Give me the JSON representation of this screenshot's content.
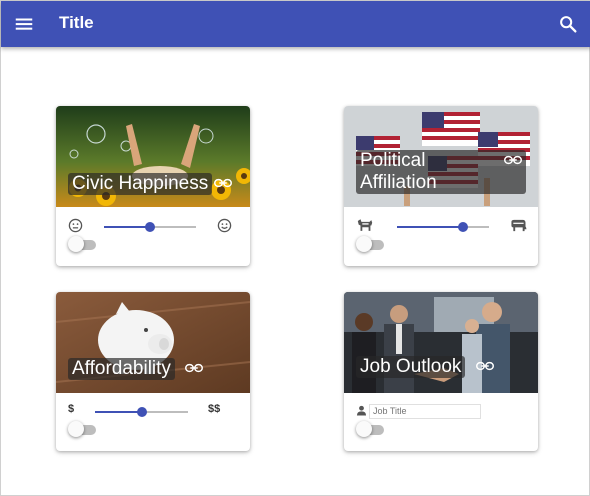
{
  "app": {
    "title": "Title"
  },
  "cards": [
    {
      "title": "Civic Happiness",
      "link_icon": "link-icon",
      "start_icon": "neutral-face-icon",
      "end_icon": "smile-face-icon",
      "slider_value": 0.5,
      "toggle_on": false
    },
    {
      "title_line1": "Political",
      "title_line2": "Affiliation",
      "link_icon": "link-icon",
      "start_icon": "donkey-icon",
      "end_icon": "elephant-icon",
      "slider_value": 0.72,
      "toggle_on": false
    },
    {
      "title": "Affordability",
      "link_icon": "link-icon",
      "start_label": "$",
      "end_label": "$$",
      "slider_value": 0.5,
      "toggle_on": false
    },
    {
      "title": "Job Outlook",
      "link_icon": "link-icon",
      "input_icon": "person-icon",
      "input_placeholder": "Job Title",
      "toggle_on": false
    }
  ],
  "colors": {
    "primary": "#3f51b5",
    "track": "#bdbdbd"
  }
}
